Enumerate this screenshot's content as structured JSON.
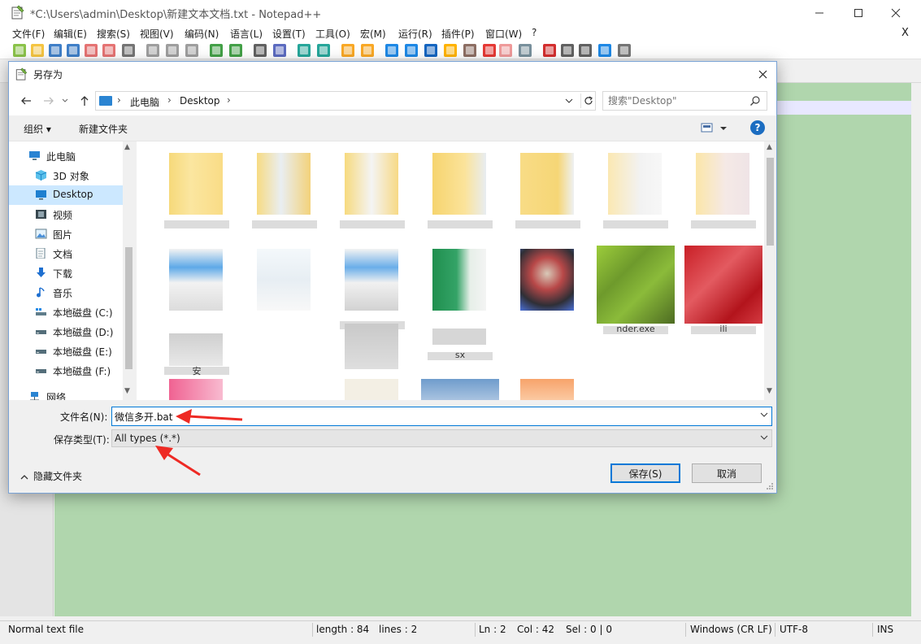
{
  "notepad": {
    "title": "*C:\\Users\\admin\\Desktop\\新建文本文档.txt - Notepad++",
    "menu": [
      "文件(F)",
      "编辑(E)",
      "搜索(S)",
      "视图(V)",
      "编码(N)",
      "语言(L)",
      "设置(T)",
      "工具(O)",
      "宏(M)",
      "运行(R)",
      "插件(P)",
      "窗口(W)",
      "?"
    ],
    "menu_close": "X",
    "status": {
      "file_type": "Normal text file",
      "length": "length : 84",
      "lines": "lines : 2",
      "ln": "Ln : 2",
      "col": "Col : 42",
      "sel": "Sel : 0 | 0",
      "eol": "Windows (CR LF)",
      "encoding": "UTF-8",
      "mode": "INS"
    },
    "colors": {
      "editor_bg": "#b0d6ad",
      "current_line": "#e8e8ff"
    }
  },
  "dialog": {
    "title": "另存为",
    "breadcrumb": [
      "此电脑",
      "Desktop"
    ],
    "search_placeholder": "搜索\"Desktop\"",
    "organize_label": "组织 ▾",
    "new_folder_label": "新建文件夹",
    "help_label": "?",
    "nav_items": [
      {
        "label": "此电脑",
        "icon": "computer-icon"
      },
      {
        "label": "3D 对象",
        "icon": "cube-3d-icon"
      },
      {
        "label": "Desktop",
        "icon": "desktop-icon",
        "selected": true
      },
      {
        "label": "视频",
        "icon": "video-icon"
      },
      {
        "label": "图片",
        "icon": "pictures-icon"
      },
      {
        "label": "文档",
        "icon": "documents-icon"
      },
      {
        "label": "下载",
        "icon": "download-icon"
      },
      {
        "label": "音乐",
        "icon": "music-icon"
      },
      {
        "label": "本地磁盘 (C:)",
        "icon": "drive-c-icon"
      },
      {
        "label": "本地磁盘 (D:)",
        "icon": "drive-icon"
      },
      {
        "label": "本地磁盘 (E:)",
        "icon": "drive-icon"
      },
      {
        "label": "本地磁盘 (F:)",
        "icon": "drive-icon"
      },
      {
        "label": "网络",
        "icon": "network-icon"
      }
    ],
    "file_labels": {
      "green_exe": "nder.exe",
      "red_app": "ili",
      "xlsx_hint": "sx",
      "doc_hint": "安"
    },
    "filename_label": "文件名(N):",
    "filename_value": "微信多开.bat",
    "filetype_label": "保存类型(T):",
    "filetype_value": "All types (*.*)",
    "hide_folders_label": "隐藏文件夹",
    "save_button": "保存(S)",
    "cancel_button": "取消"
  }
}
